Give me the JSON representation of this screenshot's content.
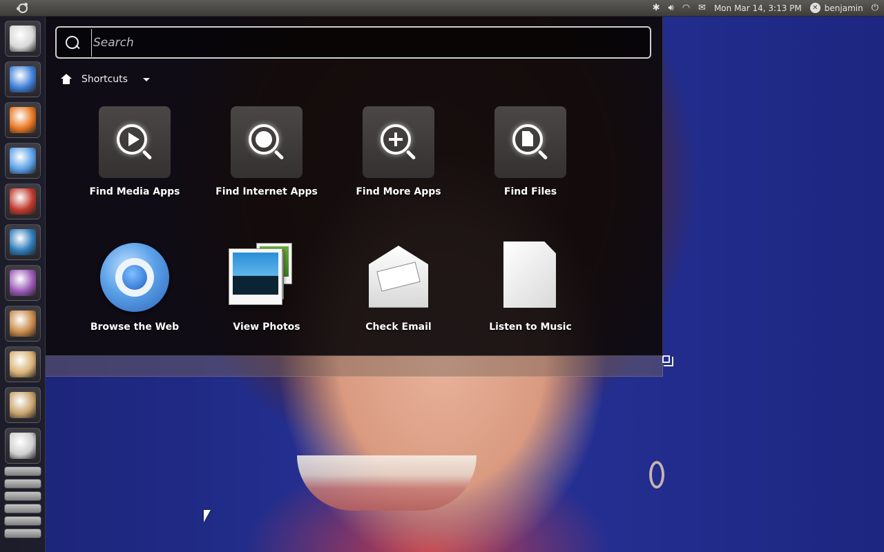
{
  "top_panel": {
    "clock": "Mon Mar 14,  3:13 PM",
    "user": "benjamin",
    "indicators": [
      "bluetooth-icon",
      "volume-icon",
      "wifi-icon",
      "mail-icon",
      "power-icon"
    ]
  },
  "launcher": {
    "items": [
      {
        "icon": "file-cabinet-icon",
        "color": "#d7d7d7"
      },
      {
        "icon": "chromium-icon",
        "color": "#3e7fd8"
      },
      {
        "icon": "firefox-icon",
        "color": "#e8761e"
      },
      {
        "icon": "banshee-icon",
        "color": "#5aa0e8"
      },
      {
        "icon": "transmission-icon",
        "color": "#c0392b"
      },
      {
        "icon": "shotwell-icon",
        "color": "#2e7bb8"
      },
      {
        "icon": "cheese-icon",
        "color": "#9b59b6"
      },
      {
        "icon": "software-center-icon",
        "color": "#c98a4a"
      },
      {
        "icon": "update-manager-icon",
        "color": "#d8b275"
      },
      {
        "icon": "package-globe-icon",
        "color": "#c9a36c"
      },
      {
        "icon": "workspaces-icon",
        "color": "#cfcfcf"
      }
    ]
  },
  "dash": {
    "search": {
      "placeholder": "Search",
      "value": ""
    },
    "place": {
      "label": "Shortcuts"
    },
    "lenses": [
      {
        "label": "Find Media Apps",
        "icon": "find-media-apps-icon"
      },
      {
        "label": "Find Internet Apps",
        "icon": "find-internet-apps-icon"
      },
      {
        "label": "Find More Apps",
        "icon": "find-more-apps-icon"
      },
      {
        "label": "Find Files",
        "icon": "find-files-icon"
      }
    ],
    "apps": [
      {
        "label": "Browse the Web",
        "icon": "chromium-icon"
      },
      {
        "label": "View Photos",
        "icon": "photos-icon"
      },
      {
        "label": "Check Email",
        "icon": "email-icon"
      },
      {
        "label": "Listen to Music",
        "icon": "music-icon"
      }
    ]
  }
}
